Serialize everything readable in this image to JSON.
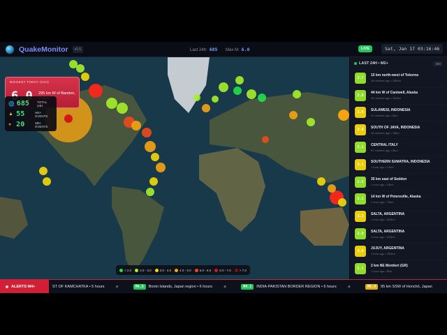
{
  "header": {
    "app_name": "QuakeMonitor",
    "version": "v1.5",
    "last24_label": "Last 24h:",
    "last24_value": "685",
    "maxm_label": "Max M:",
    "maxm_value": "6.0",
    "live": "LIVE",
    "clock": "Sat, Jan 17 03:16:46"
  },
  "biggest": {
    "title": "BIGGEST TODAY (24H)",
    "magnitude": "6.0",
    "place": "295 km W of Bandon, Oregon"
  },
  "stats": [
    {
      "value": "685",
      "label": "TOTAL 24H",
      "icon": "globe-icon"
    },
    {
      "value": "55",
      "label": "M4+ EVENTS",
      "icon": "warning-icon"
    },
    {
      "value": "20",
      "label": "M5+ EVENTS",
      "icon": "fire-icon"
    }
  ],
  "legend": [
    {
      "label": "< 2.0",
      "color": "#22e04a"
    },
    {
      "label": "2.0 - 3.0",
      "color": "#a6f02a"
    },
    {
      "label": "3.0 - 4.0",
      "color": "#f5d90a"
    },
    {
      "label": "4.0 - 5.0",
      "color": "#f5a312"
    },
    {
      "label": "5.0 - 6.0",
      "color": "#ef4a1c"
    },
    {
      "label": "6.0 - 7.0",
      "color": "#d41818"
    },
    {
      "label": "> 7.0",
      "color": "#8a0c0c"
    }
  ],
  "panel": {
    "title": "LAST 24H • M2+",
    "count": "350",
    "items": [
      {
        "mag": "2.7",
        "place": "15 km north-west of Tokoroa",
        "meta": "18 minutes ago • 266km",
        "color": "#8fdc2a"
      },
      {
        "mag": "2.0",
        "place": "44 km W of Cantwell, Alaska",
        "meta": "26 minutes ago • 102km",
        "color": "#8fdc2a"
      },
      {
        "mag": "3.0",
        "place": "SULAWESI, INDONESIA",
        "meta": "47 minutes ago • 8km",
        "color": "#eacd0c"
      },
      {
        "mag": "3.8",
        "place": "SOUTH OF JAVA, INDONESIA",
        "meta": "49 minutes ago • 18km",
        "color": "#eacd0c"
      },
      {
        "mag": "2.1",
        "place": "CENTRAL ITALY",
        "meta": "57 minutes ago • 8km",
        "color": "#8fdc2a"
      },
      {
        "mag": "3.1",
        "place": "SOUTHERN SUMATRA, INDONESIA",
        "meta": "1 hour ago • 12km",
        "color": "#eacd0c"
      },
      {
        "mag": "2.5",
        "place": "35 km east of Seddon",
        "meta": "1 hour ago • 24km",
        "color": "#8fdc2a"
      },
      {
        "mag": "2.1",
        "place": "14 km W of Petersville, Alaska",
        "meta": "1 hour ago • 73km",
        "color": "#8fdc2a"
      },
      {
        "mag": "3.3",
        "place": "SALTA, ARGENTINA",
        "meta": "1 hour ago • 209km",
        "color": "#eacd0c"
      },
      {
        "mag": "2.9",
        "place": "SALTA, ARGENTINA",
        "meta": "1 hour ago • 224km",
        "color": "#8fdc2a"
      },
      {
        "mag": "3.0",
        "place": "JUJUY, ARGENTINA",
        "meta": "1 hour ago • 252km",
        "color": "#eacd0c"
      },
      {
        "mag": "2.1",
        "place": "2 km NE Montieri (GR)",
        "meta": "1 hour ago • 8km",
        "color": "#8fdc2a"
      }
    ]
  },
  "ticker": {
    "label": "ALERTS M4+",
    "items": [
      {
        "mag": "",
        "text": "ST OF KAMCHATKA • 5 hours",
        "color": ""
      },
      {
        "mag": "M4.5",
        "text": "Bonin Islands, Japan region • 6 hours",
        "color": "#22c55e"
      },
      {
        "mag": "M4.1",
        "text": "INDIA-PAKISTAN BORDER REGION • 6 hours",
        "color": "#22c55e"
      },
      {
        "mag": "M5.4",
        "text": "95 km SSW of Honchō, Japan",
        "color": "#e5b00c"
      }
    ]
  }
}
